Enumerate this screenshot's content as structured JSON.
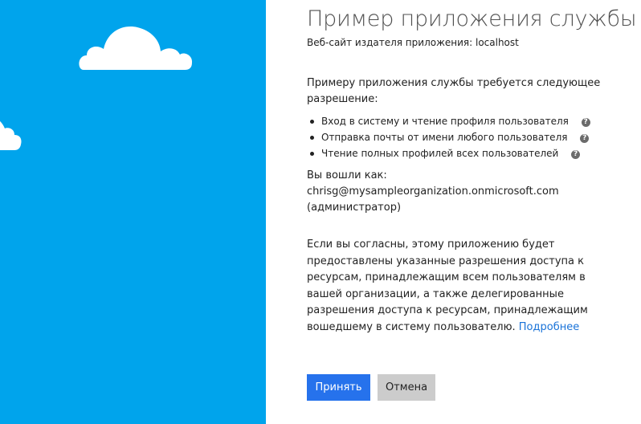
{
  "app": {
    "title": "Пример приложения службы",
    "publisher": "Веб-сайт издателя приложения: localhost"
  },
  "permissions": {
    "intro": "Примеру приложения службы требуется следующее разрешение:",
    "items": [
      {
        "label": "Вход в систему и чтение профиля пользователя",
        "icon": "help-icon"
      },
      {
        "label": "Отправка почты от имени любого пользователя",
        "icon": "help-icon"
      },
      {
        "label": "Чтение полных профилей всех пользователей",
        "icon": "help-icon"
      }
    ]
  },
  "account": {
    "signed_in_label": "Вы вошли как:",
    "email": "chrisg@mysampleorganization.onmicrosoft.com",
    "role": "(администратор)"
  },
  "consent": {
    "text": "Если вы согласны, этому приложению будет предоставлены указанные разрешения доступа к ресурсам, принадлежащим всем пользователям в вашей организации, а также делегированные разрешения доступа к ресурсам, принадлежащим вошедшему в систему пользователю.",
    "learn_more": "Подробнее"
  },
  "buttons": {
    "accept": "Принять",
    "cancel": "Отмена"
  },
  "colors": {
    "left_panel": "#00a4ec",
    "accept_button": "#2672ec",
    "cancel_button": "#cccccc",
    "link": "#1a73d8"
  }
}
